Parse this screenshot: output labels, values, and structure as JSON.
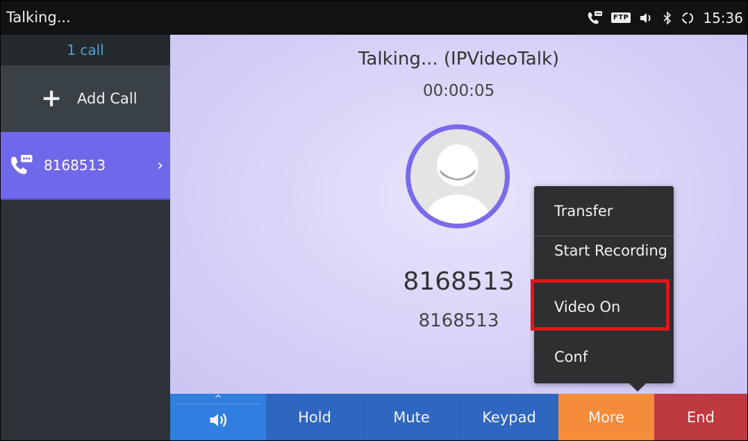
{
  "status_bar": {
    "title": "Talking...",
    "time": "15:36",
    "icons": [
      "call-chat-icon",
      "ftp-icon",
      "volume-icon",
      "bluetooth-icon",
      "sync-icon"
    ],
    "ftp_label": "FTP"
  },
  "sidebar": {
    "call_count": "1 call",
    "add_call_label": "Add Call",
    "active_call": "8168513"
  },
  "call": {
    "title": "Talking... (IPVideoTalk)",
    "duration": "00:00:05",
    "name": "8168513",
    "number": "8168513"
  },
  "menu": {
    "items": [
      "Transfer",
      "Start Recording",
      "Video On",
      "Conf"
    ],
    "highlighted": "Video On"
  },
  "toolbar": {
    "hold": "Hold",
    "mute": "Mute",
    "keypad": "Keypad",
    "more": "More",
    "end": "End"
  },
  "colors": {
    "accent_purple": "#7068ea",
    "toolbar_blue": "#2f66c0",
    "more_orange": "#f58c3a",
    "end_red": "#bf3940",
    "highlight_red": "#e0161a"
  }
}
